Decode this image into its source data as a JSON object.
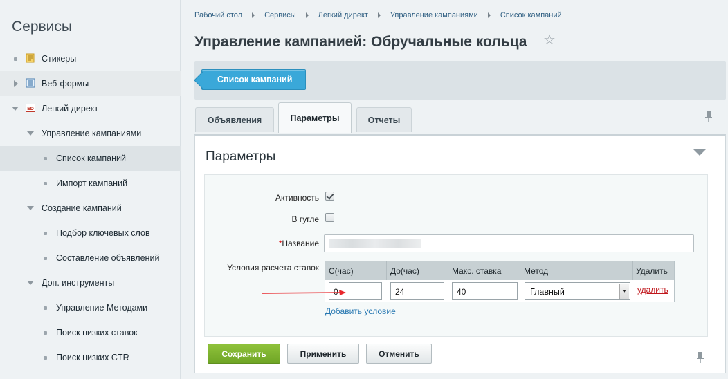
{
  "sidebar": {
    "title": "Сервисы",
    "items": [
      {
        "label": "Стикеры"
      },
      {
        "label": "Веб-формы"
      },
      {
        "label": "Легкий директ"
      },
      {
        "label": "Управление кампаниями"
      },
      {
        "label": "Список кампаний"
      },
      {
        "label": "Импорт кампаний"
      },
      {
        "label": "Создание кампаний"
      },
      {
        "label": "Подбор ключевых слов"
      },
      {
        "label": "Составление объявлений"
      },
      {
        "label": "Доп. инструменты"
      },
      {
        "label": "Управление Методами"
      },
      {
        "label": "Поиск низких ставок"
      },
      {
        "label": "Поиск низких CTR"
      }
    ]
  },
  "breadcrumb": [
    "Рабочий стол",
    "Сервисы",
    "Легкий директ",
    "Управление кампаниями",
    "Список кампаний"
  ],
  "page_title": "Управление кампанией: Обручальные кольца",
  "toolbar": {
    "list_button": "Список кампаний"
  },
  "tabs": [
    {
      "label": "Объявления"
    },
    {
      "label": "Параметры"
    },
    {
      "label": "Отчеты"
    }
  ],
  "panel": {
    "title": "Параметры",
    "fields": {
      "active_label": "Активность",
      "active_checked": true,
      "google_label": "В гугле",
      "google_checked": false,
      "name_required": "*",
      "name_label": "Название",
      "conditions_label": "Условия расчета ставок"
    },
    "table": {
      "headers": [
        "С(час)",
        "До(час)",
        "Макс. ставка",
        "Метод",
        "Удалить"
      ],
      "row": {
        "from": "0",
        "to": "24",
        "max_bid": "40",
        "method": "Главный",
        "delete": "удалить"
      }
    },
    "add_condition": "Добавить условие"
  },
  "buttons": {
    "save": "Сохранить",
    "apply": "Применить",
    "cancel": "Отменить"
  },
  "colors": {
    "accent_blue": "#3aa8d9",
    "save_green": "#7ab32e",
    "delete_red": "#c0161b",
    "annotation_arrow": "#e8262b"
  }
}
